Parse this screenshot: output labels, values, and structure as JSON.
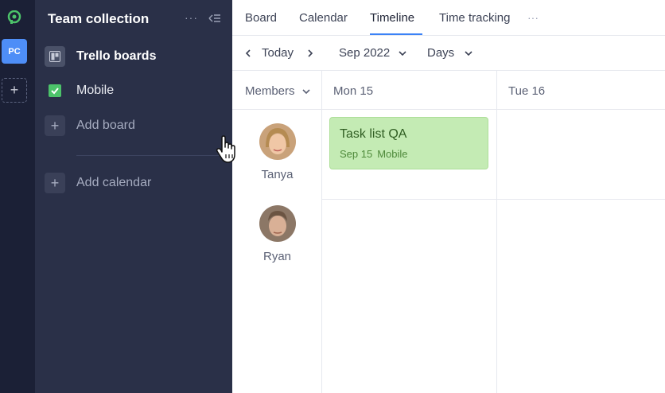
{
  "rail": {
    "workspace_label": "PC",
    "add_icon": "plus-icon"
  },
  "sidebar": {
    "title": "Team collection",
    "more_label": "···",
    "items": [
      {
        "label": "Trello boards",
        "icon": "trello-icon"
      },
      {
        "label": "Mobile",
        "icon": "checkbox-icon",
        "color": "#4cc36a"
      },
      {
        "label": "Add board",
        "icon": "plus-icon"
      },
      {
        "label": "Add calendar",
        "icon": "plus-icon"
      }
    ]
  },
  "tabs": [
    {
      "label": "Board"
    },
    {
      "label": "Calendar"
    },
    {
      "label": "Timeline",
      "active": true
    },
    {
      "label": "Time tracking"
    }
  ],
  "tabs_more": "···",
  "toolbar": {
    "today_label": "Today",
    "period_label": "Sep 2022",
    "scale_label": "Days"
  },
  "grid": {
    "members_label": "Members",
    "columns": [
      {
        "label": "Mon 15"
      },
      {
        "label": "Tue 16"
      }
    ],
    "members": [
      {
        "name": "Tanya"
      },
      {
        "name": "Ryan"
      }
    ]
  },
  "task": {
    "title": "Task list QA",
    "date": "Sep 15",
    "board": "Mobile",
    "color": "#c4ebb4"
  },
  "colors": {
    "accent": "#3b82f6",
    "sidebar_bg": "#2a3048",
    "rail_bg": "#1b2036",
    "workspace": "#4e8ef7"
  }
}
